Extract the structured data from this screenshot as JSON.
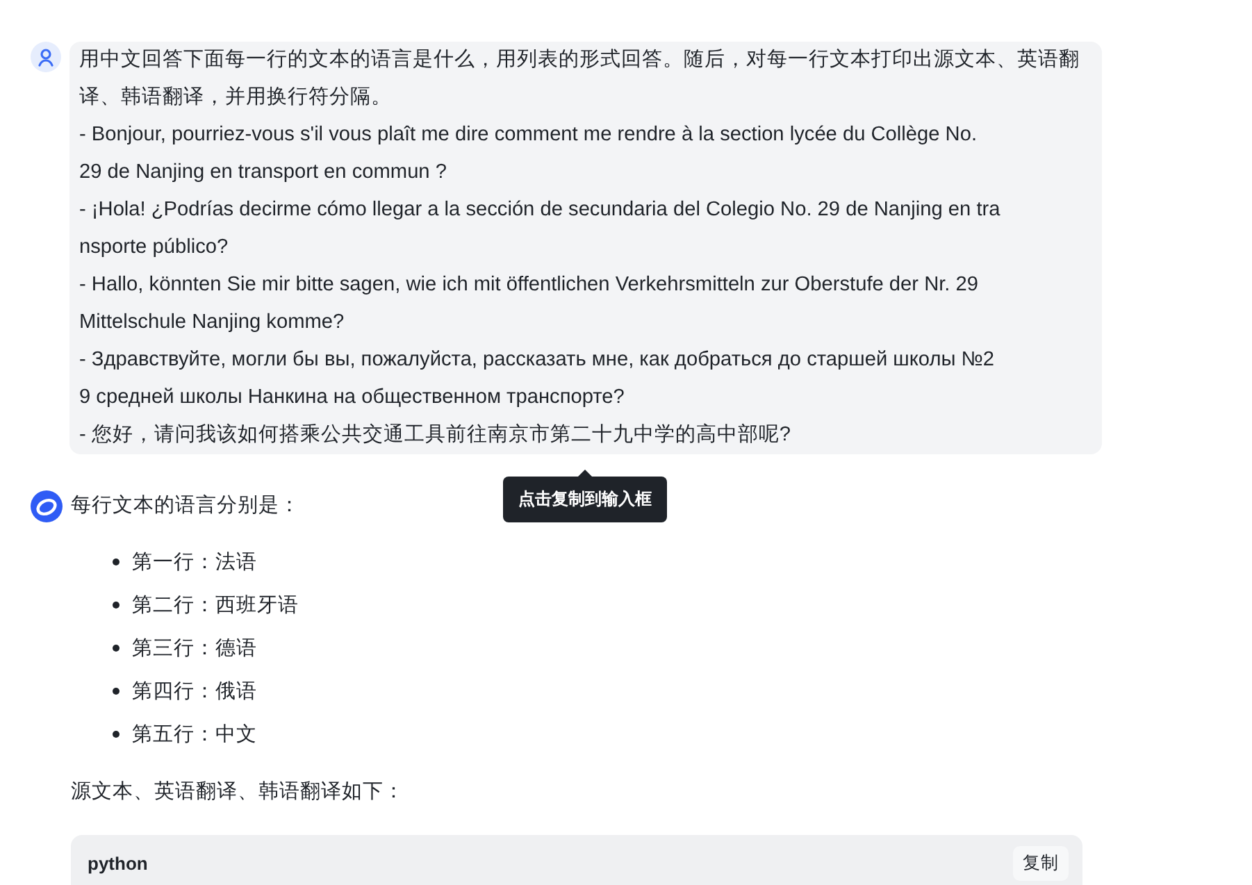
{
  "user_message": {
    "paragraphs": [
      [
        "用中文回答下面每一行的文本的语言是什么，用列表的形式回答。随后，对每一行文本打印出源文本、英语翻",
        "译、韩语翻译，并用换行符分隔。"
      ],
      [
        "- Bonjour, pourriez-vous s'il vous plaît me dire comment me rendre à la section lycée du Collège No.",
        "29 de Nanjing en transport en commun ?"
      ],
      [
        "- ¡Hola! ¿Podrías decirme cómo llegar a la sección de secundaria del Colegio No. 29 de Nanjing en tra",
        "nsporte público?"
      ],
      [
        "- Hallo, könnten Sie mir bitte sagen, wie ich mit öffentlichen Verkehrsmitteln zur Oberstufe der Nr. 29",
        "Mittelschule Nanjing komme?"
      ],
      [
        "- Здравствуйте, могли бы вы, пожалуйста, рассказать мне, как добраться до старшей школы №2",
        "9 средней школы Нанкина на общественном транспорте?"
      ],
      [
        "- 您好，请问我该如何搭乘公共交通工具前往南京市第二十九中学的高中部呢?"
      ]
    ]
  },
  "tooltip": "点击复制到输入框",
  "assistant_message": {
    "intro": "每行文本的语言分别是：",
    "items": [
      "第一行：法语",
      "第二行：西班牙语",
      "第三行：德语",
      "第四行：俄语",
      "第五行：中文"
    ],
    "outro": "源文本、英语翻译、韩语翻译如下：",
    "code_block": {
      "language": "python",
      "copy_label": "复制"
    }
  }
}
